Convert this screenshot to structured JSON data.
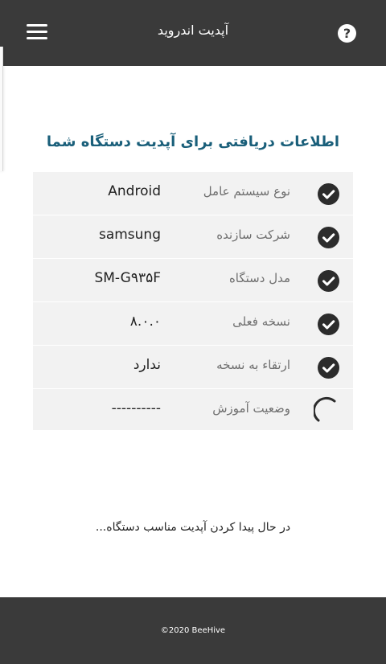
{
  "header": {
    "title": "آپدیت اندروید",
    "help_label": "?",
    "menu_icon": "hamburger-menu-icon",
    "background": "#3a3a3a"
  },
  "main": {
    "heading": "اطلاعات دریافتی برای آپدیت دستگاه شما",
    "heading_color": "#1a5f7a",
    "rows": [
      {
        "label": "نوع سیستم عامل",
        "value": "Android",
        "status": "done",
        "status_icon": "check-circle-icon"
      },
      {
        "label": "شرکت سازنده",
        "value": "samsung",
        "status": "done",
        "status_icon": "check-circle-icon"
      },
      {
        "label": "مدل دستگاه",
        "value": "SM-G۹۳۵F",
        "status": "done",
        "status_icon": "check-circle-icon"
      },
      {
        "label": "نسخه فعلی",
        "value": "۸.۰.۰",
        "status": "done",
        "status_icon": "check-circle-icon"
      },
      {
        "label": "ارتقاء به نسخه",
        "value": "ندارد",
        "status": "done",
        "status_icon": "check-circle-icon"
      },
      {
        "label": "وضعیت آموزش",
        "value": "----------",
        "status": "loading",
        "status_icon": "loading-spinner-icon"
      }
    ],
    "status_message": "در حال پیدا کردن آپدیت مناسب دستگاه..."
  },
  "footer": {
    "copyright": "©2020 BeeHive",
    "background": "#3a3a3a"
  }
}
